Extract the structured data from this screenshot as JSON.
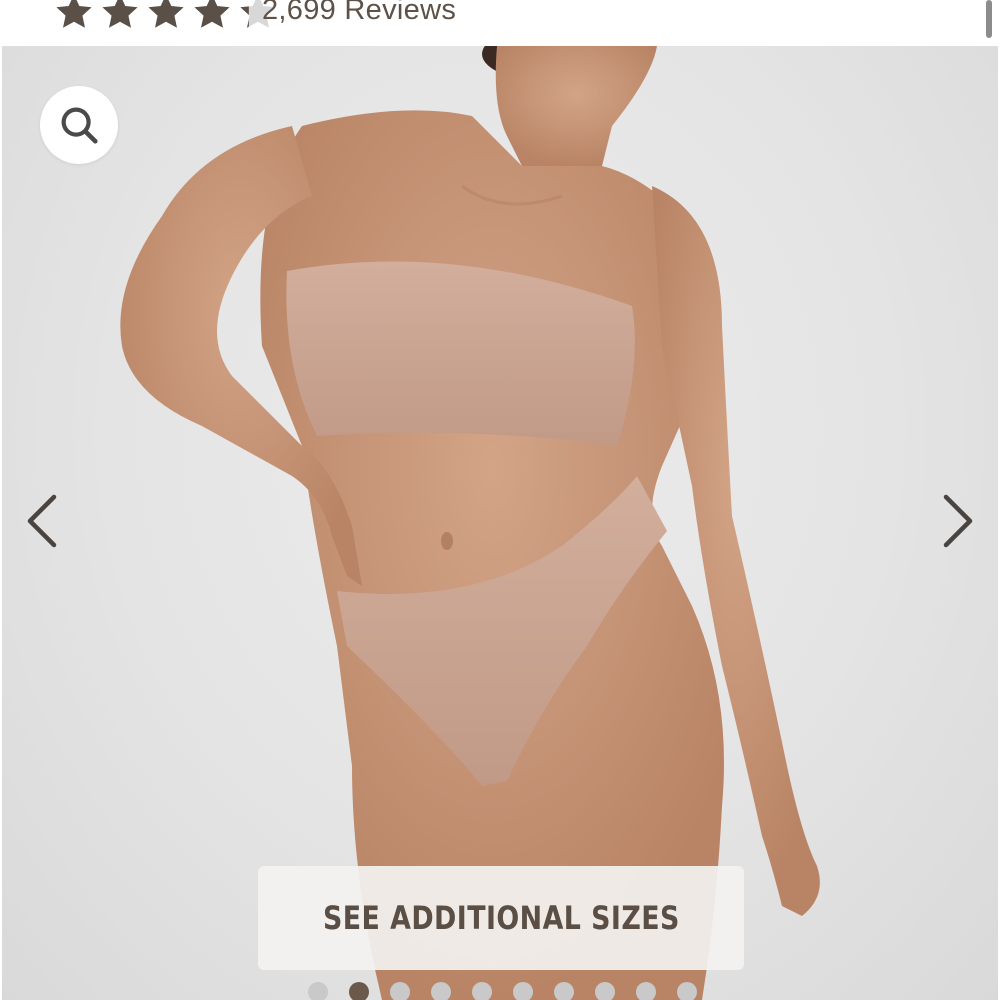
{
  "rating": {
    "value": 4.3,
    "max": 5,
    "reviews_label": "2,699 Reviews",
    "star_color": "#5a5048",
    "empty_star_color": "#d8d8d8"
  },
  "gallery": {
    "icons": {
      "search": "search-icon",
      "prev": "chevron-left-icon",
      "next": "chevron-right-icon"
    },
    "sizes_button_label": "SEE ADDITIONAL SIZES",
    "dot_count": 10,
    "active_index": 1,
    "accent": "#6b5a4c",
    "skin_tone": "#c8987a",
    "garment_color": "#c9a594"
  }
}
